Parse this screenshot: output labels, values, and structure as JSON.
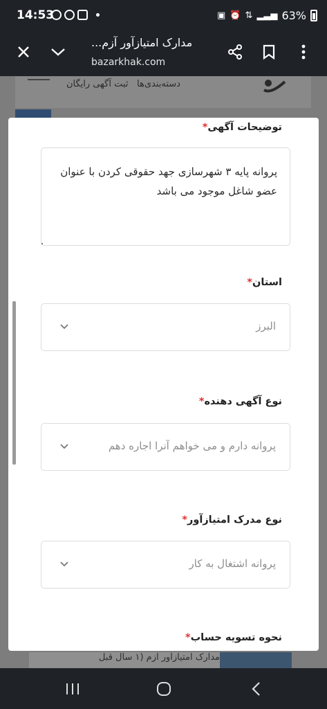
{
  "status": {
    "time": "14:53",
    "battery": "63%",
    "left_icons": [
      "whatsapp-icon",
      "alarm-icon",
      "pdf-icon"
    ],
    "right_icons": [
      "lock-icon",
      "alarm-clock-icon",
      "data-icon",
      "signal-icon",
      "battery-icon"
    ]
  },
  "browser": {
    "title": "مدارک امتیازآور آزم...",
    "url": "bazarkhak.com",
    "icons": [
      "close-icon",
      "chevron-down-icon",
      "share-icon",
      "bookmark-icon",
      "more-icon"
    ]
  },
  "background_page": {
    "nav_links": [
      "دسته‌بندی‌ها",
      "ثبت آگهی رایگان"
    ],
    "footer_text": "مدارک امتیازآور آزم   (۱ سال قبل"
  },
  "form": {
    "description": {
      "label": "توضیحات آگهی",
      "required_mark": "*",
      "value": "پروانه پایه ۳ شهرسازی جهد حقوقی کردن با عنوان عضو شاغل موجود می باشد"
    },
    "province": {
      "label": "استان",
      "required_mark": "*",
      "value": "البرز"
    },
    "advertiser_type": {
      "label": "نوع آگهی دهنده",
      "required_mark": "*",
      "value": "پروانه دارم و می خواهم آنرا اجاره دهم"
    },
    "document_type": {
      "label": "نوع مدرک امتیازآور",
      "required_mark": "*",
      "value": "پروانه اشتغال به کار"
    },
    "settlement": {
      "label": "نحوه تسویه حساب",
      "required_mark": "*"
    }
  },
  "colors": {
    "required": "#e03131",
    "system_bar": "#1f2328",
    "placeholder_text": "#8e8e8e"
  },
  "nav": {
    "icons": [
      "recent-apps-icon",
      "home-icon",
      "back-icon"
    ]
  }
}
